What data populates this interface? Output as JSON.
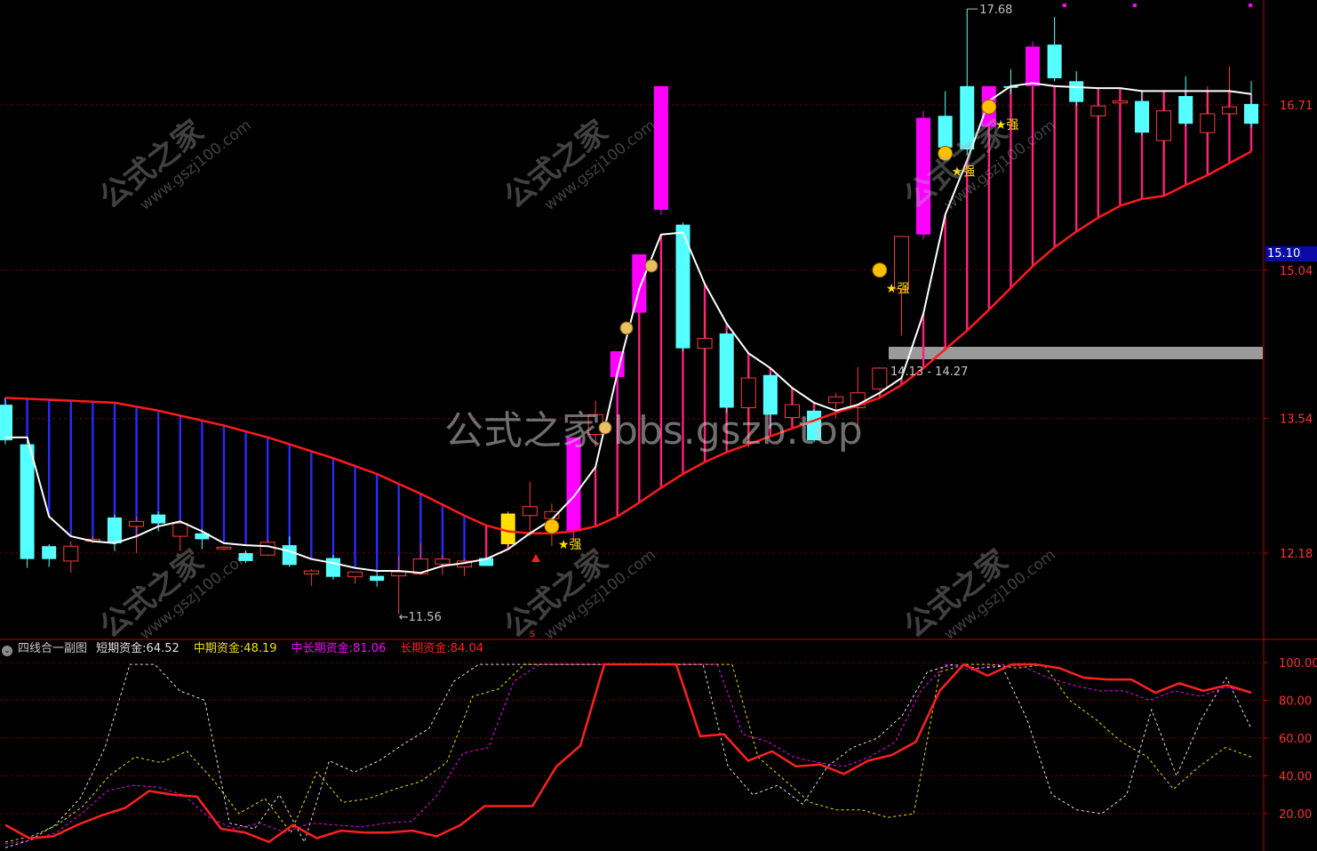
{
  "watermark": {
    "center": "公式之家 bbs.gszb.top",
    "diag_big": "公式之家",
    "diag_small": "www.gszj100.com"
  },
  "price_tag": "15.10",
  "labels": {
    "high": "17.68",
    "low": "11.56",
    "range": "14.13 - 14.27",
    "strong": "★强",
    "bottom_marker": "s"
  },
  "sub": {
    "title": "四线合一副图",
    "items": [
      {
        "label": "短期资金:",
        "value": "64.52",
        "color": "#e0e0e0"
      },
      {
        "label": "中期资金:",
        "value": "48.19",
        "color": "#f0e000"
      },
      {
        "label": "中长期资金:",
        "value": "81.06",
        "color": "#ff00ff"
      },
      {
        "label": "长期资金:",
        "value": "84.04",
        "color": "#ff2020"
      }
    ]
  },
  "colors": {
    "up": "#ff3a3a",
    "down": "#55ffff",
    "magenta": "#ff00ff",
    "yellow": "#ffe000",
    "redline": "#ff1a1a",
    "blueline": "#2a2aff",
    "pinkbar": "#ff2080",
    "grid": "#8a0000"
  },
  "chart_data": [
    {
      "type": "candlestick",
      "title": "",
      "y_ticks": [
        12.18,
        13.54,
        15.04,
        16.71
      ],
      "ylim": [
        10.8,
        18.0
      ],
      "fields": [
        "open",
        "high",
        "low",
        "close",
        "color"
      ],
      "candles": [
        [
          13.68,
          13.75,
          13.28,
          13.32,
          "down"
        ],
        [
          13.28,
          13.32,
          12.03,
          12.12,
          "down"
        ],
        [
          12.25,
          12.27,
          12.04,
          12.12,
          "down"
        ],
        [
          12.1,
          12.3,
          11.98,
          12.25,
          "up"
        ],
        [
          12.3,
          12.35,
          12.28,
          12.32,
          "up"
        ],
        [
          12.54,
          12.57,
          12.2,
          12.28,
          "down"
        ],
        [
          12.45,
          12.55,
          12.18,
          12.5,
          "up"
        ],
        [
          12.57,
          12.6,
          12.4,
          12.48,
          "down"
        ],
        [
          12.35,
          12.5,
          12.2,
          12.48,
          "up"
        ],
        [
          12.38,
          12.42,
          12.22,
          12.32,
          "down"
        ],
        [
          12.23,
          12.25,
          12.21,
          12.24,
          "up"
        ],
        [
          12.18,
          12.21,
          12.08,
          12.1,
          "down"
        ],
        [
          12.16,
          12.31,
          12.15,
          12.29,
          "up"
        ],
        [
          12.26,
          12.35,
          12.04,
          12.06,
          "down"
        ],
        [
          11.97,
          12.02,
          11.85,
          12.0,
          "up"
        ],
        [
          12.13,
          12.16,
          11.91,
          11.94,
          "down"
        ],
        [
          11.94,
          11.96,
          11.87,
          11.99,
          "up"
        ],
        [
          11.95,
          12.0,
          11.84,
          11.9,
          "down"
        ],
        [
          11.95,
          12.15,
          11.56,
          11.99,
          "up"
        ],
        [
          11.97,
          12.28,
          11.96,
          12.12,
          "up"
        ],
        [
          12.12,
          12.16,
          11.96,
          12.07,
          "up"
        ],
        [
          12.04,
          12.12,
          11.95,
          12.1,
          "up"
        ],
        [
          12.05,
          12.14,
          12.05,
          12.13,
          "down"
        ],
        [
          12.27,
          12.6,
          12.25,
          12.58,
          "yellow"
        ],
        [
          12.56,
          12.9,
          12.35,
          12.65,
          "up"
        ],
        [
          12.53,
          12.68,
          12.25,
          12.6,
          "up"
        ],
        [
          12.4,
          13.35,
          12.3,
          13.35,
          "magenta"
        ],
        [
          13.38,
          13.72,
          13.25,
          13.58,
          "up"
        ],
        [
          13.96,
          14.22,
          13.6,
          14.22,
          "magenta"
        ],
        [
          14.61,
          15.2,
          14.55,
          15.2,
          "magenta"
        ],
        [
          15.65,
          16.9,
          15.6,
          16.9,
          "magenta"
        ],
        [
          15.5,
          15.52,
          14.22,
          14.25,
          "down"
        ],
        [
          14.35,
          14.62,
          13.9,
          14.25,
          "up"
        ],
        [
          14.4,
          14.42,
          13.6,
          13.65,
          "down"
        ],
        [
          13.65,
          14.0,
          13.25,
          13.95,
          "up"
        ],
        [
          13.98,
          14.0,
          13.44,
          13.58,
          "down"
        ],
        [
          13.55,
          13.85,
          13.5,
          13.68,
          "up"
        ],
        [
          13.62,
          13.63,
          13.3,
          13.32,
          "down"
        ],
        [
          13.7,
          13.8,
          13.54,
          13.76,
          "up"
        ],
        [
          13.65,
          14.06,
          13.45,
          13.8,
          "up"
        ],
        [
          13.84,
          14.06,
          13.82,
          14.05,
          "up"
        ],
        [
          14.85,
          15.38,
          14.38,
          15.38,
          "up"
        ],
        [
          15.4,
          16.65,
          15.35,
          16.58,
          "magenta"
        ],
        [
          16.6,
          16.85,
          16.14,
          16.28,
          "down"
        ],
        [
          16.26,
          17.68,
          16.2,
          16.9,
          "down"
        ],
        [
          16.49,
          16.88,
          16.45,
          16.9,
          "magenta"
        ],
        [
          16.9,
          17.07,
          16.82,
          16.9,
          "down"
        ],
        [
          16.9,
          17.35,
          16.88,
          17.3,
          "magenta"
        ],
        [
          17.32,
          17.6,
          16.95,
          16.98,
          "down"
        ],
        [
          16.95,
          17.05,
          16.7,
          16.74,
          "down"
        ],
        [
          16.6,
          16.72,
          16.55,
          16.7,
          "up"
        ],
        [
          16.75,
          16.78,
          16.7,
          16.73,
          "up"
        ],
        [
          16.75,
          16.85,
          16.4,
          16.43,
          "down"
        ],
        [
          16.35,
          16.72,
          16.2,
          16.65,
          "up"
        ],
        [
          16.8,
          17.0,
          16.5,
          16.52,
          "down"
        ],
        [
          16.43,
          16.9,
          16.4,
          16.62,
          "up"
        ],
        [
          16.62,
          17.1,
          16.6,
          16.69,
          "up"
        ],
        [
          16.72,
          16.95,
          16.48,
          16.52,
          "down"
        ]
      ],
      "ma_short": [
        13.75,
        13.74,
        13.73,
        13.72,
        13.71,
        13.7,
        13.66,
        13.62,
        13.57,
        13.52,
        13.47,
        13.41,
        13.35,
        13.28,
        13.21,
        13.14,
        13.06,
        12.98,
        12.88,
        12.78,
        12.67,
        12.56,
        12.46,
        12.4,
        12.38,
        12.38,
        12.4,
        12.45,
        12.55,
        12.69,
        12.84,
        12.98,
        13.1,
        13.2,
        13.28,
        13.36,
        13.44,
        13.52,
        13.6,
        13.67,
        13.75,
        13.88,
        14.05,
        14.24,
        14.43,
        14.64,
        14.86,
        15.08,
        15.27,
        15.43,
        15.57,
        15.69,
        15.76,
        15.79,
        15.9,
        16.0,
        16.12,
        16.24
      ],
      "ma_long": [
        13.35,
        13.35,
        12.55,
        12.35,
        12.3,
        12.28,
        12.35,
        12.45,
        12.5,
        12.4,
        12.28,
        12.26,
        12.25,
        12.2,
        12.12,
        12.08,
        12.03,
        12.0,
        12.0,
        11.98,
        12.05,
        12.08,
        12.12,
        12.22,
        12.38,
        12.52,
        12.75,
        13.05,
        14.0,
        14.85,
        15.4,
        15.42,
        14.9,
        14.5,
        14.2,
        14.05,
        13.85,
        13.7,
        13.62,
        13.68,
        13.8,
        13.95,
        14.6,
        15.6,
        16.15,
        16.75,
        16.9,
        16.93,
        16.9,
        16.89,
        16.88,
        16.88,
        16.85,
        16.85,
        16.85,
        16.85,
        16.85,
        16.82
      ]
    },
    {
      "type": "line",
      "title": "四线合一副图",
      "y_ticks": [
        20.0,
        40.0,
        60.0,
        80.0,
        100.0
      ],
      "ylim": [
        0,
        104
      ],
      "series": [
        {
          "name": "短期资金",
          "style": "dashed",
          "color": "#e0e0e0",
          "values": [
            2,
            6,
            14,
            28,
            55,
            99,
            99,
            85,
            80,
            15,
            12,
            30,
            5,
            48,
            42,
            48,
            57,
            65,
            90,
            99,
            99,
            99,
            99,
            99,
            99,
            99,
            99,
            99,
            99,
            45,
            30,
            35,
            25,
            45,
            55,
            60,
            72,
            95,
            99,
            97,
            98,
            70,
            30,
            22,
            20,
            30,
            75,
            40,
            70,
            92,
            65
          ]
        },
        {
          "name": "中期资金",
          "style": "dashed",
          "color": "#f0e000",
          "values": [
            5,
            8,
            14,
            24,
            40,
            50,
            47,
            53,
            38,
            20,
            28,
            10,
            42,
            26,
            28,
            33,
            37,
            47,
            82,
            86,
            99,
            99,
            99,
            99,
            99,
            99,
            99,
            99,
            99,
            50,
            38,
            26,
            22,
            22,
            18,
            20,
            95,
            99,
            99,
            97,
            99,
            80,
            70,
            58,
            50,
            33,
            45,
            55,
            50
          ]
        },
        {
          "name": "中长期资金",
          "style": "dashed",
          "color": "#ff00ff",
          "values": [
            4,
            6,
            10,
            20,
            32,
            35,
            34,
            30,
            18,
            12,
            15,
            10,
            15,
            14,
            13,
            15,
            16,
            30,
            52,
            55,
            90,
            99,
            99,
            99,
            99,
            99,
            99,
            99,
            99,
            62,
            58,
            50,
            47,
            45,
            50,
            58,
            85,
            99,
            96,
            99,
            98,
            92,
            88,
            85,
            85,
            80,
            85,
            82,
            87,
            84
          ]
        },
        {
          "name": "长期资金",
          "style": "solid",
          "color": "#ff2020",
          "values": [
            14,
            7,
            8,
            14,
            19,
            23,
            32,
            30,
            29,
            12,
            10,
            5,
            14,
            7,
            11,
            10,
            10,
            11,
            8,
            14,
            24,
            24,
            24,
            45,
            56,
            99,
            99,
            99,
            99,
            61,
            62,
            48,
            53,
            45,
            46,
            41,
            48,
            51,
            58,
            85,
            99,
            93,
            99,
            99,
            97,
            92,
            91,
            91,
            84,
            89,
            85,
            88,
            84
          ]
        }
      ]
    }
  ]
}
